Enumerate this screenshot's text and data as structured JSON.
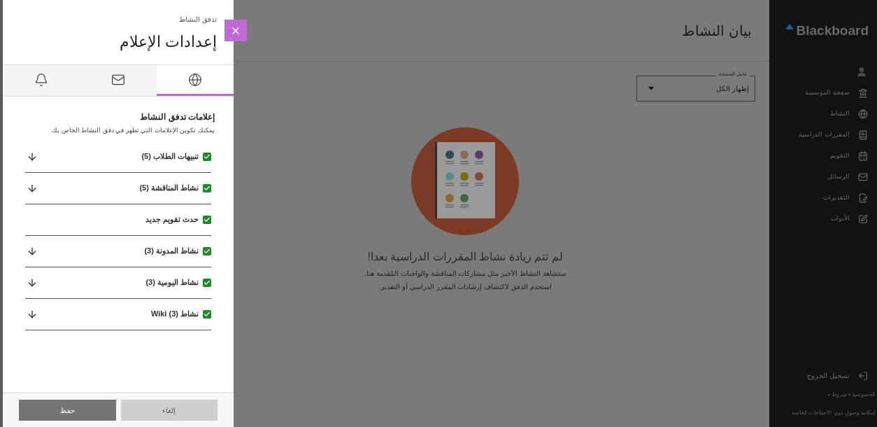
{
  "panel": {
    "breadcrumb": "تدفق النشاط",
    "title": "إعدادات الإعلام",
    "tabs": [
      {
        "kind": "globe",
        "selected": true
      },
      {
        "kind": "mail",
        "selected": false
      },
      {
        "kind": "bell",
        "selected": false
      }
    ],
    "heading": "إعلامات تدفق النشاط",
    "description": "يمكنك تكوين الإعلامات التي تظهر في دفق النشاط الخاص بك",
    "items": [
      {
        "label": "تنبيهات الطلاب (5)",
        "checked": true,
        "expandable": true
      },
      {
        "label": "نشاط المناقشة (5)",
        "checked": true,
        "expandable": true
      },
      {
        "label": "حدث تقويم جديد",
        "checked": true,
        "expandable": false
      },
      {
        "label": "نشاط المدونة (3)",
        "checked": true,
        "expandable": true
      },
      {
        "label": "نشاط اليومية (3)",
        "checked": true,
        "expandable": true
      },
      {
        "label": "نشاط (3) Wiki",
        "checked": true,
        "expandable": true
      }
    ],
    "buttons": [
      {
        "kind": "cancel",
        "label": "إلغاء"
      },
      {
        "kind": "save",
        "label": "حفظ"
      }
    ]
  },
  "page": {
    "title": "بيان النشاط",
    "filter": {
      "legend": "عامل الصفحة",
      "value": "إظهار الكل"
    },
    "empty_title": "لم تتم زيادة نشاط المقررات الدراسية بعدا!",
    "empty_lines": [
      "ستشاهد النشاط الأخير مثل مشاركات المناقشة والواجبات المُقدمة هنا.",
      "استخدم الدفق لاكتشاف إرشادات المقرر الدراسي أو التقدير."
    ]
  },
  "sidebar": {
    "logo": "Blackboard",
    "items": [
      {
        "kind": "institution",
        "label": "صفحة المؤسسة"
      },
      {
        "kind": "globe",
        "label": "النشاط"
      },
      {
        "kind": "courses",
        "label": "المقررات الدراسية"
      },
      {
        "kind": "calendar",
        "label": "التقويم"
      },
      {
        "kind": "mail",
        "label": "الرسائل"
      },
      {
        "kind": "grades",
        "label": "التقديرات"
      },
      {
        "kind": "tools",
        "label": "الأدوات"
      }
    ],
    "logout": "تسجيل الخروج",
    "legal": "الخصوصية • شروط •",
    "accessibility": "إمكانية وصول ذوي الاحتياجات الخاصة"
  }
}
